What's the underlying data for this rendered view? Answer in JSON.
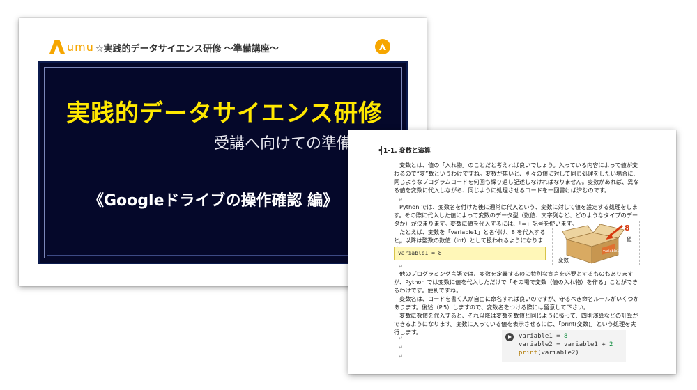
{
  "slide": {
    "logo_text": "umu",
    "header_title": "☆実践的データサイエンス研修 ～準備講座～",
    "main_title": "実践的データサイエンス研修",
    "sub_title": "受講へ向けての準備",
    "edition_title": "《Googleドライブの操作確認 編》",
    "accent_color": "#ffe800",
    "panel_color": "#05082a"
  },
  "doc": {
    "section_title": "1-1. 変数と演算",
    "para1": "変数とは、値の「入れ物」のことだと考えれば良いでしょう。入っている内容によって値が変わるので“変”数というわけですね。変数が無いと、別々の値に対して同じ処理をしたい場合に、同じようなプログラムコードを何回も繰り返し記述しなければなりません。変数があれば、異なる値を変数に代入しながら、同じように処理させるコードを一回書けば済むのです。",
    "para2": "Python では、変数名を付けた後に通常は代入という、変数に対して値を設定する処理をします。その際に代入した値によって変数のデータ型（数値、文字列など、どのようなタイプのデータか）が決まります。変数に値を代入するには、「=」記号を使います。",
    "para3": "たとえば、変数を「variable1」と名付け、8 を代入すると、以降は整数の数値（int）として扱われるようになります。",
    "inline_code": "variable1 = 8",
    "illus_number": "8",
    "illus_value_label": "値",
    "illus_var_label": "変数",
    "para4": "他のプログラミング言語では、変数を定義するのに特別な宣言を必要とするものもありますが、Python では変数に値を代入しただけで「その場で変数（値の入れ物）を作る」ことができるわけです。便利ですね。",
    "para5": "変数名は、コードを書く人が自由に命名すれば良いのですが、守るべき命名ルールがいくつかあります。後述（P.5）しますので、変数名をつける際には留意して下さい。",
    "para6": "変数に数値を代入すると、それ以降は変数を数値と同じように扱って、四則演算などの計算ができるようになります。変数に入っている値を表示させるには、「print(変数)」という処理を実行します。",
    "code_lines": [
      {
        "a": "variable1 = ",
        "b": "8",
        "c": ""
      },
      {
        "a": "variable2 = variable1 + ",
        "b": "2",
        "c": ""
      },
      {
        "a": "",
        "b": "",
        "c": "print",
        "d": "(variable2)"
      }
    ]
  }
}
